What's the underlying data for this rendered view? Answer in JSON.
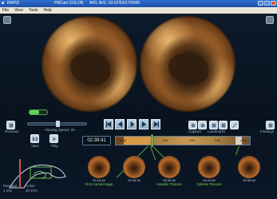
{
  "window": {
    "app_name": "RAPID",
    "center_text": "PillCam COLON",
    "patient_id": "AV0, AV0, 19:107",
    "date": "10/17/2006"
  },
  "menu": [
    "File",
    "View",
    "Tools",
    "Help"
  ],
  "controls": {
    "previous_label": "Previous",
    "speed_label": "Viewing Speed: 25",
    "capture_label": "Capture",
    "landmarks_label": "Landmarks",
    "findings_label": "Findings",
    "view_label": "View",
    "play_label": "Play"
  },
  "timeline": {
    "current_time": "02:39:41",
    "tick_labels": [
      "00:28",
      "1:00",
      "2:00",
      "3:00",
      "4:00"
    ]
  },
  "thumbnails": [
    {
      "time": "00:16:44",
      "label": "First Cecal image"
    },
    {
      "time": "02:26:35",
      "label": ""
    },
    {
      "time": "02:39:33",
      "label": "Hepatic Flexure"
    },
    {
      "time": "02:41:52",
      "label": "Splenic Flexure"
    },
    {
      "time": "02:59:53",
      "label": ""
    }
  ],
  "body_map": {
    "passage_label": "Passage",
    "passage_value": "1 min",
    "colon_label": "Colon",
    "colon_value": "2h 57m"
  },
  "colors": {
    "title_bar": "#1d4fa8",
    "background": "#07111d",
    "landmark_green": "#7cd84c"
  }
}
